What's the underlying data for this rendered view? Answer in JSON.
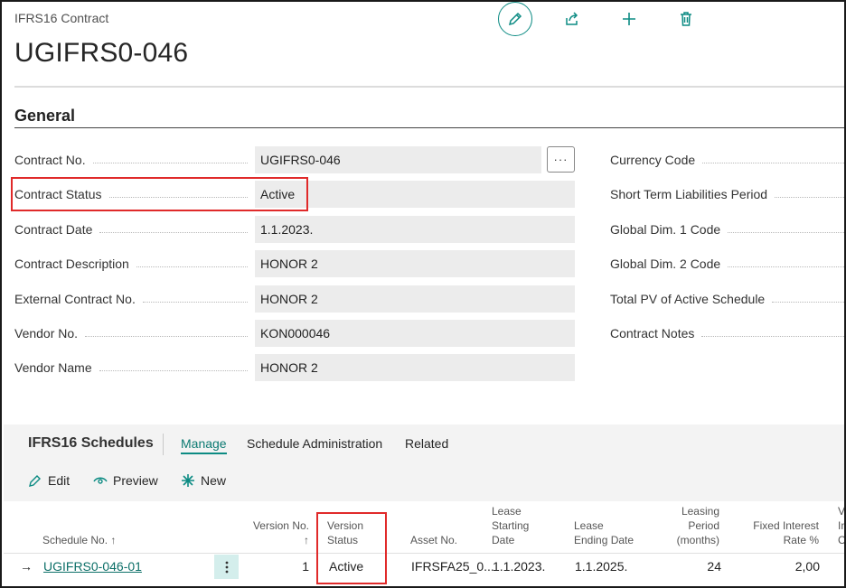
{
  "header": {
    "breadcrumb": "IFRS16 Contract",
    "title": "UGIFRS0-046"
  },
  "actions": {
    "edit_icon": "pencil-icon",
    "share_icon": "share-icon",
    "new_icon": "plus-icon",
    "delete_icon": "trash-icon"
  },
  "general": {
    "section_title": "General",
    "left_fields": [
      {
        "label": "Contract No.",
        "value": "UGIFRS0-046"
      },
      {
        "label": "Contract Status",
        "value": "Active"
      },
      {
        "label": "Contract Date",
        "value": "1.1.2023."
      },
      {
        "label": "Contract Description",
        "value": "HONOR 2"
      },
      {
        "label": "External Contract No.",
        "value": "HONOR 2"
      },
      {
        "label": "Vendor No.",
        "value": "KON000046"
      },
      {
        "label": "Vendor Name",
        "value": "HONOR 2"
      }
    ],
    "assist_button": "···",
    "right_fields": [
      {
        "label": "Currency Code"
      },
      {
        "label": "Short Term Liabilities Period"
      },
      {
        "label": "Global Dim. 1 Code"
      },
      {
        "label": "Global Dim. 2 Code"
      },
      {
        "label": "Total PV of Active Schedule"
      },
      {
        "label": "Contract Notes"
      }
    ]
  },
  "schedules": {
    "title": "IFRS16 Schedules",
    "tabs": [
      "Manage",
      "Schedule Administration",
      "Related"
    ],
    "active_tab": "Manage",
    "toolbar": {
      "edit": "Edit",
      "preview": "Preview",
      "new": "New"
    },
    "columns": {
      "schedule_no": "Schedule No. ↑",
      "version_no_1": "Version No.",
      "version_no_2": "↑",
      "version_status_1": "Version",
      "version_status_2": "Status",
      "asset_no": "Asset No.",
      "lease_start_1": "Lease",
      "lease_start_2": "Starting",
      "lease_start_3": "Date",
      "lease_end_1": "Lease",
      "lease_end_2": "Ending Date",
      "leasing_period_1": "Leasing",
      "leasing_period_2": "Period",
      "leasing_period_3": "(months)",
      "fixed_interest_1": "Fixed Interest",
      "fixed_interest_2": "Rate %",
      "cut_1": "Va",
      "cut_2": "In",
      "cut_3": "Co"
    },
    "rows": [
      {
        "arrow": "→",
        "schedule_no": "UGIFRS0-046-01",
        "version_no": "1",
        "version_status": "Active",
        "asset_no": "IFRSFA25_0...",
        "lease_start": "1.1.2023.",
        "lease_end": "1.1.2025.",
        "leasing_period": "24",
        "fixed_interest": "2,00"
      }
    ]
  },
  "colors": {
    "accent": "#0c8b83",
    "highlight": "#e02a2a"
  }
}
